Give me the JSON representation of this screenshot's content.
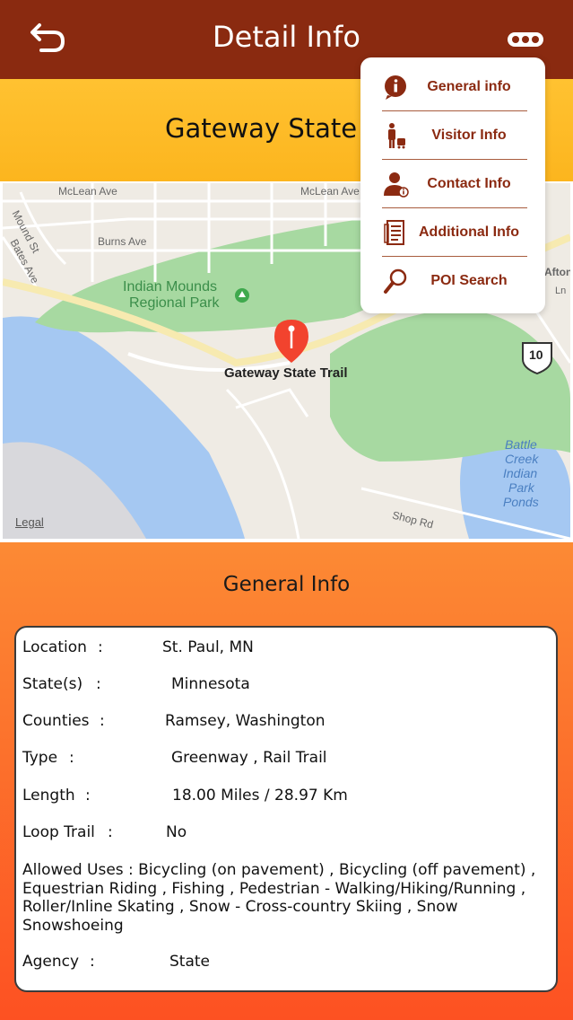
{
  "navbar": {
    "title": "Detail Info"
  },
  "trail": {
    "title": "Gateway State Trail"
  },
  "map": {
    "pin_label": "Gateway State Trail",
    "park_label_1": "Indian Mounds",
    "park_label_2": "Regional Park",
    "streets": [
      "McLean Ave",
      "McLean Ave",
      "Burns Ave",
      "Mound St",
      "Bates Ave",
      "Shop Rd",
      "Afton",
      "Ln"
    ],
    "lake_label": [
      "Battle",
      "Creek",
      "Indian",
      "Park",
      "Ponds"
    ],
    "highway_shield": "10",
    "legal": "Legal"
  },
  "section": {
    "heading": "General Info"
  },
  "info": {
    "location_label": "Location",
    "location_value": "St. Paul, MN",
    "states_label": "State(s)",
    "states_value": "Minnesota",
    "counties_label": "Counties",
    "counties_value": "Ramsey, Washington",
    "type_label": "Type",
    "type_value": "Greenway , Rail Trail",
    "length_label": "Length",
    "length_value": "18.00 Miles / 28.97 Km",
    "loop_label": "Loop Trail",
    "loop_value": "No",
    "allowed_text": "Allowed Uses  :  Bicycling (on pavement) , Bicycling (off pavement) , Equestrian  Riding , Fishing , Pedestrian - Walking/Hiking/Running , Roller/Inline Skating , Snow - Cross-country Skiing , Snow Snowshoeing",
    "agency_label": "Agency",
    "agency_value": "State",
    "separator": ":"
  },
  "menu": {
    "items": [
      {
        "label": "General info",
        "icon": "info-icon"
      },
      {
        "label": "Visitor Info",
        "icon": "traveler-icon"
      },
      {
        "label": "Contact Info",
        "icon": "contact-person-icon"
      },
      {
        "label": "Additional Info",
        "icon": "document-icon"
      },
      {
        "label": "POI Search",
        "icon": "magnifier-icon"
      }
    ]
  },
  "colors": {
    "navbar": "#8a2a10",
    "title_band": "#fcb51e",
    "lower_gradient_top": "#fc8a34",
    "lower_gradient_bottom": "#fd5122",
    "menu_text": "#8b2a11",
    "pin": "#f2432e"
  }
}
